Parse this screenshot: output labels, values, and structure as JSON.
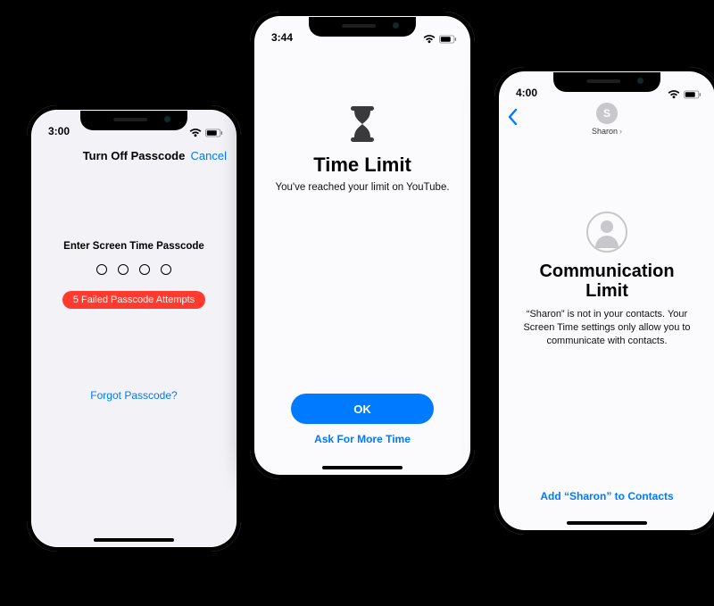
{
  "phone1": {
    "time": "3:00",
    "nav_title": "Turn Off Passcode",
    "nav_cancel": "Cancel",
    "prompt": "Enter Screen Time Passcode",
    "error_text": "5 Failed Passcode Attempts",
    "forgot_link": "Forgot Passcode?"
  },
  "phone2": {
    "time": "3:44",
    "title": "Time Limit",
    "subtitle": "You've reached your limit on YouTube.",
    "ok_label": "OK",
    "ask_more_label": "Ask For More Time"
  },
  "phone3": {
    "time": "4:00",
    "contact_initial": "S",
    "contact_name": "Sharon",
    "title": "Communication Limit",
    "description": "“Sharon” is not in your contacts. Your Screen Time settings only allow you to communicate with contacts.",
    "add_link": "Add “Sharon” to Contacts"
  },
  "colors": {
    "ios_blue": "#007aff",
    "ios_red": "#ff3b30"
  }
}
